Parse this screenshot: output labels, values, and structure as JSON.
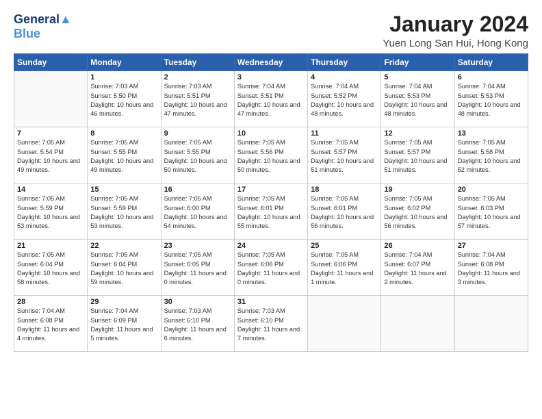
{
  "logo": {
    "line1": "General",
    "line2": "Blue",
    "bird_unicode": "🐦"
  },
  "title": "January 2024",
  "subtitle": "Yuen Long San Hui, Hong Kong",
  "header_days": [
    "Sunday",
    "Monday",
    "Tuesday",
    "Wednesday",
    "Thursday",
    "Friday",
    "Saturday"
  ],
  "weeks": [
    [
      {
        "day": "",
        "sunrise": "",
        "sunset": "",
        "daylight": ""
      },
      {
        "day": "1",
        "sunrise": "Sunrise: 7:03 AM",
        "sunset": "Sunset: 5:50 PM",
        "daylight": "Daylight: 10 hours and 46 minutes."
      },
      {
        "day": "2",
        "sunrise": "Sunrise: 7:03 AM",
        "sunset": "Sunset: 5:51 PM",
        "daylight": "Daylight: 10 hours and 47 minutes."
      },
      {
        "day": "3",
        "sunrise": "Sunrise: 7:04 AM",
        "sunset": "Sunset: 5:51 PM",
        "daylight": "Daylight: 10 hours and 47 minutes."
      },
      {
        "day": "4",
        "sunrise": "Sunrise: 7:04 AM",
        "sunset": "Sunset: 5:52 PM",
        "daylight": "Daylight: 10 hours and 48 minutes."
      },
      {
        "day": "5",
        "sunrise": "Sunrise: 7:04 AM",
        "sunset": "Sunset: 5:53 PM",
        "daylight": "Daylight: 10 hours and 48 minutes."
      },
      {
        "day": "6",
        "sunrise": "Sunrise: 7:04 AM",
        "sunset": "Sunset: 5:53 PM",
        "daylight": "Daylight: 10 hours and 48 minutes."
      }
    ],
    [
      {
        "day": "7",
        "sunrise": "Sunrise: 7:05 AM",
        "sunset": "Sunset: 5:54 PM",
        "daylight": "Daylight: 10 hours and 49 minutes."
      },
      {
        "day": "8",
        "sunrise": "Sunrise: 7:05 AM",
        "sunset": "Sunset: 5:55 PM",
        "daylight": "Daylight: 10 hours and 49 minutes."
      },
      {
        "day": "9",
        "sunrise": "Sunrise: 7:05 AM",
        "sunset": "Sunset: 5:55 PM",
        "daylight": "Daylight: 10 hours and 50 minutes."
      },
      {
        "day": "10",
        "sunrise": "Sunrise: 7:05 AM",
        "sunset": "Sunset: 5:56 PM",
        "daylight": "Daylight: 10 hours and 50 minutes."
      },
      {
        "day": "11",
        "sunrise": "Sunrise: 7:05 AM",
        "sunset": "Sunset: 5:57 PM",
        "daylight": "Daylight: 10 hours and 51 minutes."
      },
      {
        "day": "12",
        "sunrise": "Sunrise: 7:05 AM",
        "sunset": "Sunset: 5:57 PM",
        "daylight": "Daylight: 10 hours and 51 minutes."
      },
      {
        "day": "13",
        "sunrise": "Sunrise: 7:05 AM",
        "sunset": "Sunset: 5:58 PM",
        "daylight": "Daylight: 10 hours and 52 minutes."
      }
    ],
    [
      {
        "day": "14",
        "sunrise": "Sunrise: 7:05 AM",
        "sunset": "Sunset: 5:59 PM",
        "daylight": "Daylight: 10 hours and 53 minutes."
      },
      {
        "day": "15",
        "sunrise": "Sunrise: 7:05 AM",
        "sunset": "Sunset: 5:59 PM",
        "daylight": "Daylight: 10 hours and 53 minutes."
      },
      {
        "day": "16",
        "sunrise": "Sunrise: 7:05 AM",
        "sunset": "Sunset: 6:00 PM",
        "daylight": "Daylight: 10 hours and 54 minutes."
      },
      {
        "day": "17",
        "sunrise": "Sunrise: 7:05 AM",
        "sunset": "Sunset: 6:01 PM",
        "daylight": "Daylight: 10 hours and 55 minutes."
      },
      {
        "day": "18",
        "sunrise": "Sunrise: 7:05 AM",
        "sunset": "Sunset: 6:01 PM",
        "daylight": "Daylight: 10 hours and 56 minutes."
      },
      {
        "day": "19",
        "sunrise": "Sunrise: 7:05 AM",
        "sunset": "Sunset: 6:02 PM",
        "daylight": "Daylight: 10 hours and 56 minutes."
      },
      {
        "day": "20",
        "sunrise": "Sunrise: 7:05 AM",
        "sunset": "Sunset: 6:03 PM",
        "daylight": "Daylight: 10 hours and 57 minutes."
      }
    ],
    [
      {
        "day": "21",
        "sunrise": "Sunrise: 7:05 AM",
        "sunset": "Sunset: 6:04 PM",
        "daylight": "Daylight: 10 hours and 58 minutes."
      },
      {
        "day": "22",
        "sunrise": "Sunrise: 7:05 AM",
        "sunset": "Sunset: 6:04 PM",
        "daylight": "Daylight: 10 hours and 59 minutes."
      },
      {
        "day": "23",
        "sunrise": "Sunrise: 7:05 AM",
        "sunset": "Sunset: 6:05 PM",
        "daylight": "Daylight: 11 hours and 0 minutes."
      },
      {
        "day": "24",
        "sunrise": "Sunrise: 7:05 AM",
        "sunset": "Sunset: 6:06 PM",
        "daylight": "Daylight: 11 hours and 0 minutes."
      },
      {
        "day": "25",
        "sunrise": "Sunrise: 7:05 AM",
        "sunset": "Sunset: 6:06 PM",
        "daylight": "Daylight: 11 hours and 1 minute."
      },
      {
        "day": "26",
        "sunrise": "Sunrise: 7:04 AM",
        "sunset": "Sunset: 6:07 PM",
        "daylight": "Daylight: 11 hours and 2 minutes."
      },
      {
        "day": "27",
        "sunrise": "Sunrise: 7:04 AM",
        "sunset": "Sunset: 6:08 PM",
        "daylight": "Daylight: 11 hours and 3 minutes."
      }
    ],
    [
      {
        "day": "28",
        "sunrise": "Sunrise: 7:04 AM",
        "sunset": "Sunset: 6:08 PM",
        "daylight": "Daylight: 11 hours and 4 minutes."
      },
      {
        "day": "29",
        "sunrise": "Sunrise: 7:04 AM",
        "sunset": "Sunset: 6:09 PM",
        "daylight": "Daylight: 11 hours and 5 minutes."
      },
      {
        "day": "30",
        "sunrise": "Sunrise: 7:03 AM",
        "sunset": "Sunset: 6:10 PM",
        "daylight": "Daylight: 11 hours and 6 minutes."
      },
      {
        "day": "31",
        "sunrise": "Sunrise: 7:03 AM",
        "sunset": "Sunset: 6:10 PM",
        "daylight": "Daylight: 11 hours and 7 minutes."
      },
      {
        "day": "",
        "sunrise": "",
        "sunset": "",
        "daylight": ""
      },
      {
        "day": "",
        "sunrise": "",
        "sunset": "",
        "daylight": ""
      },
      {
        "day": "",
        "sunrise": "",
        "sunset": "",
        "daylight": ""
      }
    ]
  ]
}
